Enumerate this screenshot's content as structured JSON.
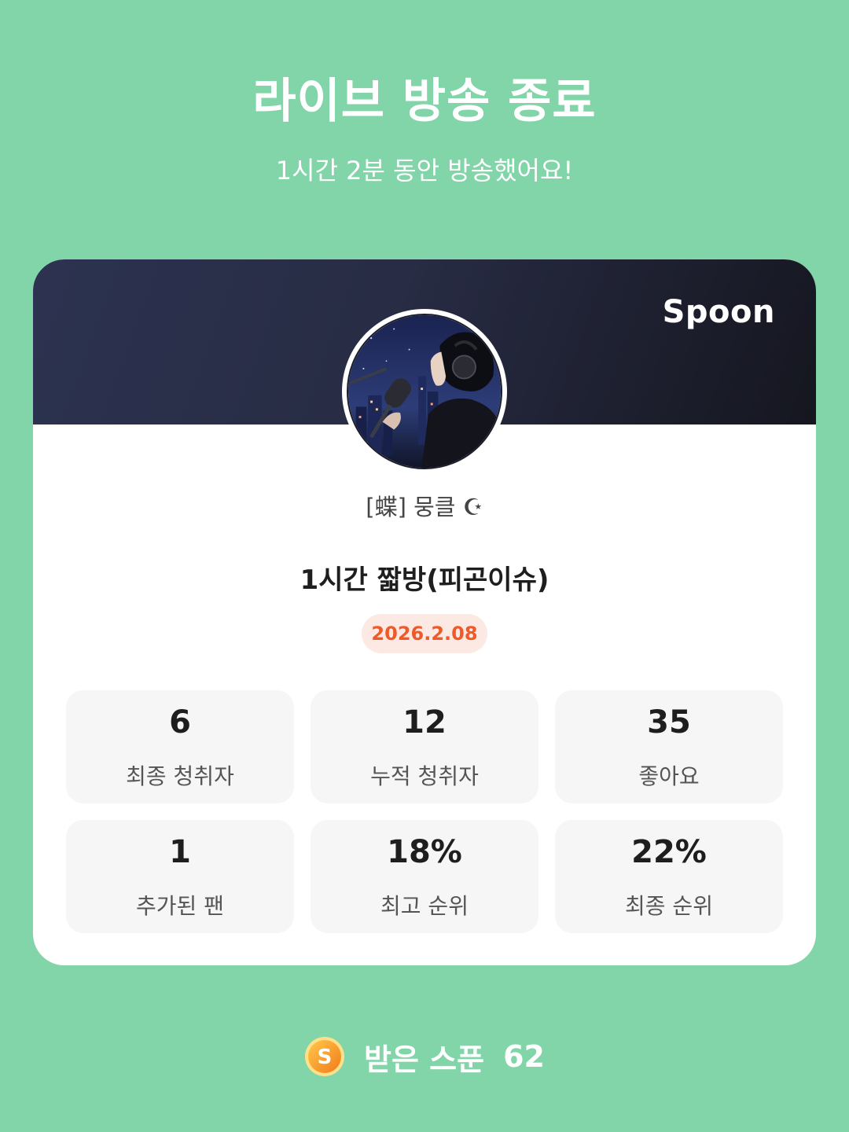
{
  "header": {
    "title": "라이브 방송 종료",
    "subtitle": "1시간 2분 동안 방송했어요!"
  },
  "card": {
    "brand": "Spoon",
    "nickname": "[蝶] 뭉클 ☪",
    "live_title": "1시간 짧방(피곤이슈)",
    "date": "2026.2.08",
    "stats": [
      {
        "value": "6",
        "label": "최종 청취자"
      },
      {
        "value": "12",
        "label": "누적 청취자"
      },
      {
        "value": "35",
        "label": "좋아요"
      },
      {
        "value": "1",
        "label": "추가된 팬"
      },
      {
        "value": "18%",
        "label": "최고 순위"
      },
      {
        "value": "22%",
        "label": "최종 순위"
      }
    ]
  },
  "footer": {
    "label": "받은 스푼",
    "value": "62",
    "icon": "spoon-coin-icon"
  },
  "colors": {
    "background": "#82d5a8",
    "accent": "#f05a28",
    "header_dark": "#282c44"
  }
}
